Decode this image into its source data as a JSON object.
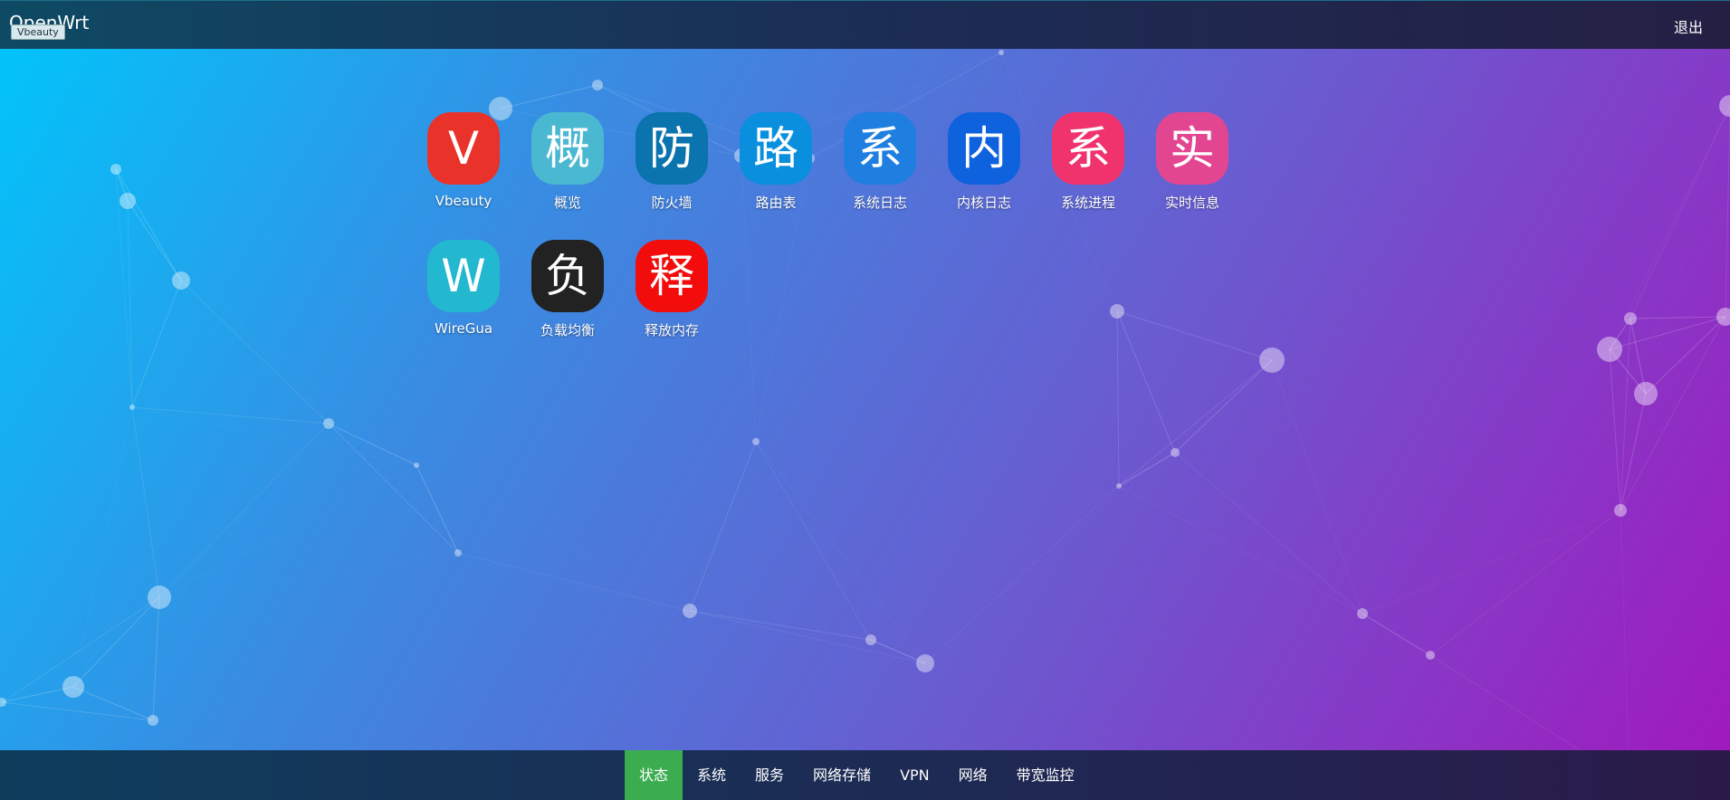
{
  "header": {
    "brand": "OpenWrt",
    "tooltip": "Vbeauty",
    "logout_label": "退出"
  },
  "apps": [
    {
      "glyph": "V",
      "label": "Vbeauty",
      "color": "#e8322a",
      "icon": "vbeauty-icon"
    },
    {
      "glyph": "概",
      "label": "概览",
      "color": "#4ab8d1",
      "icon": "overview-icon"
    },
    {
      "glyph": "防",
      "label": "防火墙",
      "color": "#0b73ad",
      "icon": "firewall-icon"
    },
    {
      "glyph": "路",
      "label": "路由表",
      "color": "#0a8fde",
      "icon": "routes-icon"
    },
    {
      "glyph": "系",
      "label": "系统日志",
      "color": "#1f7fe0",
      "icon": "syslog-icon"
    },
    {
      "glyph": "内",
      "label": "内核日志",
      "color": "#0f62dd",
      "icon": "kernel-log-icon"
    },
    {
      "glyph": "系",
      "label": "系统进程",
      "color": "#f0336c",
      "icon": "processes-icon"
    },
    {
      "glyph": "实",
      "label": "实时信息",
      "color": "#e34691",
      "icon": "realtime-icon"
    },
    {
      "glyph": "W",
      "label": "WireGua",
      "color": "#22b8cf",
      "icon": "wireguard-icon"
    },
    {
      "glyph": "负",
      "label": "负载均衡",
      "color": "#222222",
      "icon": "load-balance-icon"
    },
    {
      "glyph": "释",
      "label": "释放内存",
      "color": "#f20c0c",
      "icon": "free-memory-icon"
    }
  ],
  "bottom_menu": {
    "items": [
      {
        "label": "状态",
        "active": true
      },
      {
        "label": "系统",
        "active": false
      },
      {
        "label": "服务",
        "active": false
      },
      {
        "label": "网络存储",
        "active": false
      },
      {
        "label": "VPN",
        "active": false
      },
      {
        "label": "网络",
        "active": false
      },
      {
        "label": "带宽监控",
        "active": false
      }
    ]
  }
}
